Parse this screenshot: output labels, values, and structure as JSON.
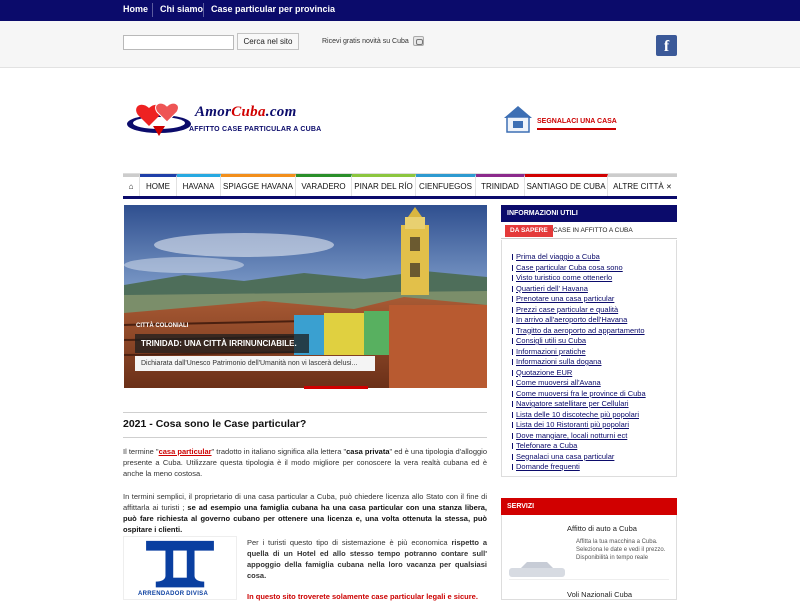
{
  "topnav": [
    "Home",
    "Chi siamo",
    "Case particular per provincia"
  ],
  "search": {
    "placeholder": "",
    "button": "Cerca nel sito"
  },
  "newsletter": "Ricevi gratis novità su Cuba",
  "logo": {
    "name_a": "Amor",
    "name_b": "Cuba",
    "name_c": ".com",
    "tagline": "AFFITTO CASE PARTICULAR A CUBA"
  },
  "report_button": "SEGNALACI UNA CASA",
  "menu": [
    "HOME",
    "HAVANA",
    "SPIAGGE HAVANA",
    "VARADERO",
    "PINAR DEL RÍO",
    "CIENFUEGOS",
    "TRINIDAD",
    "SANTIAGO DE CUBA",
    "ALTRE CITTÀ"
  ],
  "menu_colors": [
    "#cccccc",
    "#1f3fa8",
    "#27a9e1",
    "#f28f1c",
    "#2a8f2a",
    "#8cc63f",
    "#2e9ad0",
    "#8b2a8b",
    "#d10000"
  ],
  "slider": {
    "tag": "CITTÀ COLONIALI",
    "title": "TRINIDAD: UNA CITTÀ IRRINUNCIABILE.",
    "desc": "Dichiarata dall'Unesco Patrimonio dell'Umanità non vi lascerà delusi..."
  },
  "article": {
    "title": "2021 - Cosa sono le Case particular?",
    "p1a": "Il termine \"",
    "p1link": "casa particular",
    "p1b": "\"  tradotto in italiano significa alla lettera \"",
    "p1bold": "casa privata",
    "p1c": "\" ed è una tipologia d'alloggio presente a Cuba. Utilizzare questa tipologia è il modo migliore per conoscere la vera realtà cubana ed è anche la meno costosa.",
    "p2a": "In termini semplici, il proprietario di una casa particular a Cuba, può chiedere licenza allo Stato con il fine di affittarla ai turisti ; ",
    "p2bold": "se ad esempio una famiglia cubana ha una casa particular con una stanza libera, può fare richiesta al governo cubano per ottenere una licenza e, una volta ottenuta la stessa,  può  ospitare i clienti.",
    "logo_text": "ARRENDADOR DIVISA",
    "p3a": "Per i turisti questo tipo di sistemazione è più economica ",
    "p3bold": "rispetto a quella di un Hotel ed allo stesso tempo potranno contare sull' appoggio della famiglia cubana nella loro vacanza per qualsiasi cosa.",
    "p4": "In questo sito troverete solamente case particular legali e sicure."
  },
  "info": {
    "header": "INFORMAZIONI UTILI",
    "tab_active": "DA SAPERE",
    "tab_other": "CASE IN AFFITTO A CUBA",
    "links": [
      "Prima del viaggio a Cuba",
      "Case particular Cuba cosa sono",
      "Visto turistico come ottenerlo",
      "Quartieri dell' Havana",
      "Prenotare una casa particular",
      "Prezzi case particular e qualità",
      "In arrivo all'aeroporto dell'Havana",
      "Tragitto da aeroporto ad appartamento",
      "Consigli utili su Cuba",
      "Informazioni pratiche",
      "Informazioni sulla dogana",
      "Quotazione EUR",
      "Come muoversi all'Avana",
      "Come muoversi fra le province di Cuba",
      "Navigatore satellitare per Cellulari",
      "Lista delle 10 discoteche più popolari",
      "Lista dei 10 Ristoranti più popolari",
      "Dove mangiare, locali notturni ect",
      "Telefonare a Cuba",
      "Segnalaci una casa particular",
      "Domande frequenti"
    ]
  },
  "services": {
    "header": "SERVIZI",
    "s1_title": "Affitto di auto a Cuba",
    "s1_desc": "Affitta la tua macchina a Cuba. Seleziona le date e vedi il prezzo. Disponibilità in tempo reale",
    "s2_title": "Voli Nazionali Cuba"
  }
}
